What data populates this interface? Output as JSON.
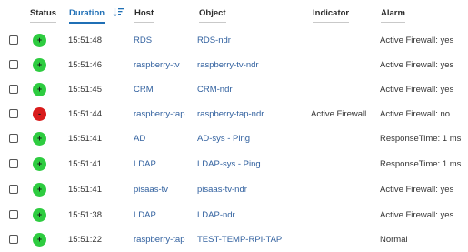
{
  "columns": {
    "status": "Status",
    "duration": "Duration",
    "host": "Host",
    "object": "Object",
    "indicator": "Indicator",
    "alarm": "Alarm"
  },
  "colors": {
    "ok": "#2ecc40",
    "down": "#d91c1c",
    "link": "#2f5f9e",
    "sort_accent": "#1f6fb5"
  },
  "rows": [
    {
      "status": "ok",
      "symbol": "+",
      "time": "15:51:48",
      "host": "RDS",
      "object": "RDS-ndr",
      "indicator": "",
      "alarm": "Active Firewall: yes"
    },
    {
      "status": "ok",
      "symbol": "+",
      "time": "15:51:46",
      "host": "raspberry-tv",
      "object": "raspberry-tv-ndr",
      "indicator": "",
      "alarm": "Active Firewall: yes"
    },
    {
      "status": "ok",
      "symbol": "+",
      "time": "15:51:45",
      "host": "CRM",
      "object": "CRM-ndr",
      "indicator": "",
      "alarm": "Active Firewall: yes"
    },
    {
      "status": "down",
      "symbol": "-",
      "time": "15:51:44",
      "host": "raspberry-tap",
      "object": "raspberry-tap-ndr",
      "indicator": "Active Firewall",
      "alarm": "Active Firewall: no"
    },
    {
      "status": "ok",
      "symbol": "+",
      "time": "15:51:41",
      "host": "AD",
      "object": "AD-sys - Ping",
      "indicator": "",
      "alarm": "ResponseTime: 1 ms"
    },
    {
      "status": "ok",
      "symbol": "+",
      "time": "15:51:41",
      "host": "LDAP",
      "object": "LDAP-sys - Ping",
      "indicator": "",
      "alarm": "ResponseTime: 1 ms"
    },
    {
      "status": "ok",
      "symbol": "+",
      "time": "15:51:41",
      "host": "pisaas-tv",
      "object": "pisaas-tv-ndr",
      "indicator": "",
      "alarm": "Active Firewall: yes"
    },
    {
      "status": "ok",
      "symbol": "+",
      "time": "15:51:38",
      "host": "LDAP",
      "object": "LDAP-ndr",
      "indicator": "",
      "alarm": "Active Firewall: yes"
    },
    {
      "status": "ok",
      "symbol": "+",
      "time": "15:51:22",
      "host": "raspberry-tap",
      "object": "TEST-TEMP-RPI-TAP",
      "indicator": "",
      "alarm": "Normal"
    }
  ]
}
